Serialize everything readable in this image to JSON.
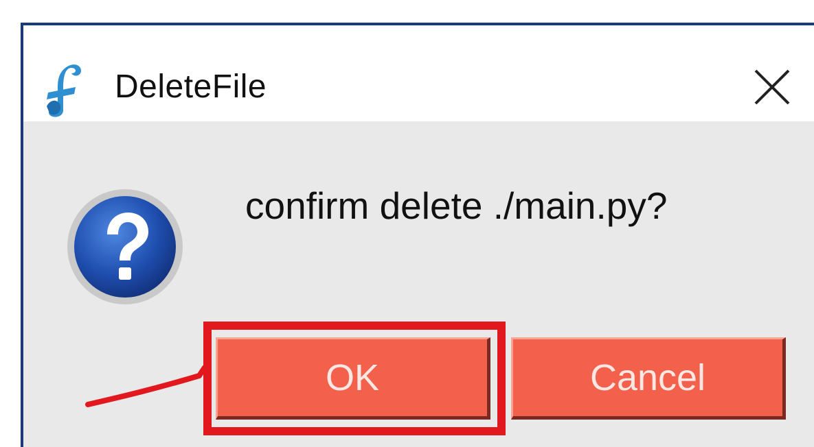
{
  "window": {
    "title": "DeleteFile",
    "app_icon": "app-logo-icon",
    "close_icon": "close-icon"
  },
  "dialog": {
    "icon": "question-icon",
    "message": "confirm delete ./main.py?"
  },
  "buttons": {
    "ok_label": "OK",
    "cancel_label": "Cancel"
  },
  "annotation": {
    "highlight_target": "ok-button",
    "highlight_color": "#e2181f"
  },
  "colors": {
    "button_fill": "#f3614c",
    "dialog_border": "#1b3b78",
    "body_background": "#e9e9e9"
  }
}
